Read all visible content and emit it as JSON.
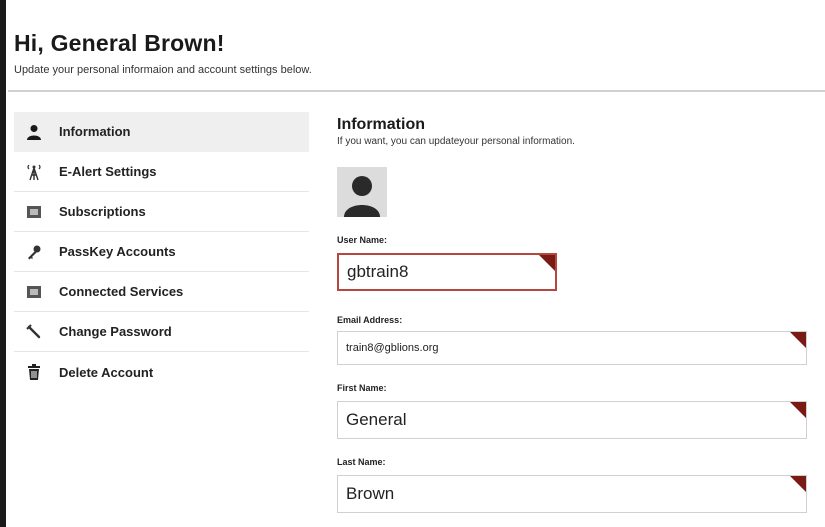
{
  "header": {
    "greeting": "Hi, General Brown!",
    "subtitle": "Update your personal informaion and account settings below."
  },
  "sidebar": {
    "items": [
      {
        "label": "Information",
        "icon": "user-icon",
        "active": true
      },
      {
        "label": "E-Alert Settings",
        "icon": "antenna-icon"
      },
      {
        "label": "Subscriptions",
        "icon": "subscriptions-icon"
      },
      {
        "label": "PassKey Accounts",
        "icon": "key-icon"
      },
      {
        "label": "Connected Services",
        "icon": "connected-services-icon"
      },
      {
        "label": "Change Password",
        "icon": "wrench-icon"
      },
      {
        "label": "Delete Account",
        "icon": "trash-icon"
      }
    ]
  },
  "main": {
    "title": "Information",
    "description": "If you want, you can updateyour personal information.",
    "fields": {
      "username": {
        "label": "User Name:",
        "value": "gbtrain8"
      },
      "email": {
        "label": "Email Address:",
        "value": "train8@gblions.org"
      },
      "first_name": {
        "label": "First Name:",
        "value": "General"
      },
      "last_name": {
        "label": "Last Name:",
        "value": "Brown"
      }
    }
  },
  "colors": {
    "accent": "#7a1a14",
    "focus_border": "#b5483e",
    "active_bg": "#efefef"
  }
}
